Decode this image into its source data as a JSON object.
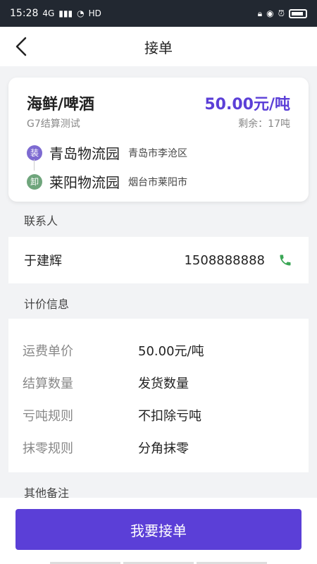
{
  "status": {
    "time": "15:28",
    "network": "4G",
    "hd": "HD"
  },
  "header": {
    "title": "接单"
  },
  "order": {
    "goods": "海鲜/啤酒",
    "subtitle": "G7结算测试",
    "price": "50.00元/吨",
    "remaining": "剩余：17吨",
    "load": {
      "badge": "装",
      "place": "青岛物流园",
      "city": "青岛市李沧区"
    },
    "unload": {
      "badge": "卸",
      "place": "莱阳物流园",
      "city": "烟台市莱阳市"
    }
  },
  "contact": {
    "section_title": "联系人",
    "name": "于建辉",
    "phone": "1508888888"
  },
  "pricing": {
    "section_title": "计价信息",
    "rows": [
      {
        "label": "运费单价",
        "value": "50.00元/吨"
      },
      {
        "label": "结算数量",
        "value": "发货数量"
      },
      {
        "label": "亏吨规则",
        "value": "不扣除亏吨"
      },
      {
        "label": "抹零规则",
        "value": "分角抹零"
      }
    ]
  },
  "remarks": {
    "section_title": "其他备注"
  },
  "actions": {
    "accept_label": "我要接单"
  },
  "colors": {
    "accent": "#5b3fd7",
    "phone_icon": "#3aa655",
    "load_badge": "#7d6ad1",
    "unload_badge": "#6fa57c"
  },
  "icons": {
    "back": "chevron-left-icon",
    "phone": "phone-icon"
  }
}
